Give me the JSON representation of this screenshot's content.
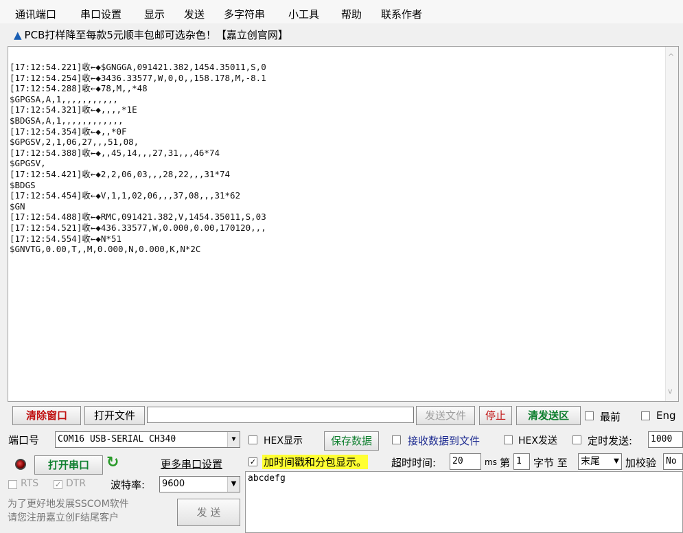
{
  "menu": [
    "通讯端口",
    "串口设置",
    "显示",
    "发送",
    "多字符串",
    "小工具",
    "帮助",
    "联系作者"
  ],
  "ad": {
    "marker": "▲",
    "text": "PCB打样降至每款5元顺丰包邮可选杂色！【嘉立创官网】"
  },
  "receive": {
    "lines": [
      "[17:12:54.221]收←◆$GNGGA,091421.382,1454.35011,S,0",
      "[17:12:54.254]收←◆3436.33577,W,0,0,,158.178,M,-8.1",
      "[17:12:54.288]收←◆78,M,,*48",
      "$GPGSA,A,1,,,,,,,,,,,",
      "[17:12:54.321]收←◆,,,,*1E",
      "$BDGSA,A,1,,,,,,,,,,,,",
      "[17:12:54.354]收←◆,,*0F",
      "$GPGSV,2,1,06,27,,,51,08,",
      "[17:12:54.388]收←◆,,45,14,,,27,31,,,46*74",
      "$GPGSV,",
      "[17:12:54.421]收←◆2,2,06,03,,,28,22,,,31*74",
      "$BDGS",
      "[17:12:54.454]收←◆V,1,1,02,06,,,37,08,,,31*62",
      "$GN",
      "[17:12:54.488]收←◆RMC,091421.382,V,1454.35011,S,03",
      "[17:12:54.521]收←◆436.33577,W,0.000,0.00,170120,,,",
      "[17:12:54.554]收←◆N*51",
      "$GNVTG,0.00,T,,M,0.000,N,0.000,K,N*2C"
    ],
    "scroll_up": "^",
    "scroll_down": "v"
  },
  "toolbar": {
    "clear_window": "清除窗口",
    "open_file": "打开文件",
    "file_path": "",
    "send_file": "发送文件",
    "stop": "停止",
    "clear_send": "清发送区",
    "topmost": "最前",
    "english": "Eng"
  },
  "port": {
    "port_label": "端口号",
    "port_value": "COM16 USB-SERIAL CH340",
    "hex_display": "HEX显示",
    "save_data": "保存数据",
    "recv_to_file": "接收数据到文件",
    "hex_send": "HEX发送",
    "timed_send": "定时发送:",
    "timed_value": "1000",
    "open_port": "打开串口",
    "more_settings": "更多串口设置",
    "timestamp": "加时间戳和分包显示。",
    "timeout_label": "超时时间:",
    "timeout_value": "20",
    "ms": "ms",
    "di": "第",
    "byte_from": "1",
    "byte_unit": "字节 至",
    "byte_to": "末尾",
    "checksum_label": "加校验",
    "checksum_value": "No",
    "rts": "RTS",
    "dtr": "DTR",
    "baud_label": "波特率:",
    "baud_value": "9600",
    "send_button": "发 送",
    "send_text": "abcdefg",
    "footer_line1": "为了更好地发展SSCOM软件",
    "footer_line2": "请您注册嘉立创F结尾客户"
  }
}
